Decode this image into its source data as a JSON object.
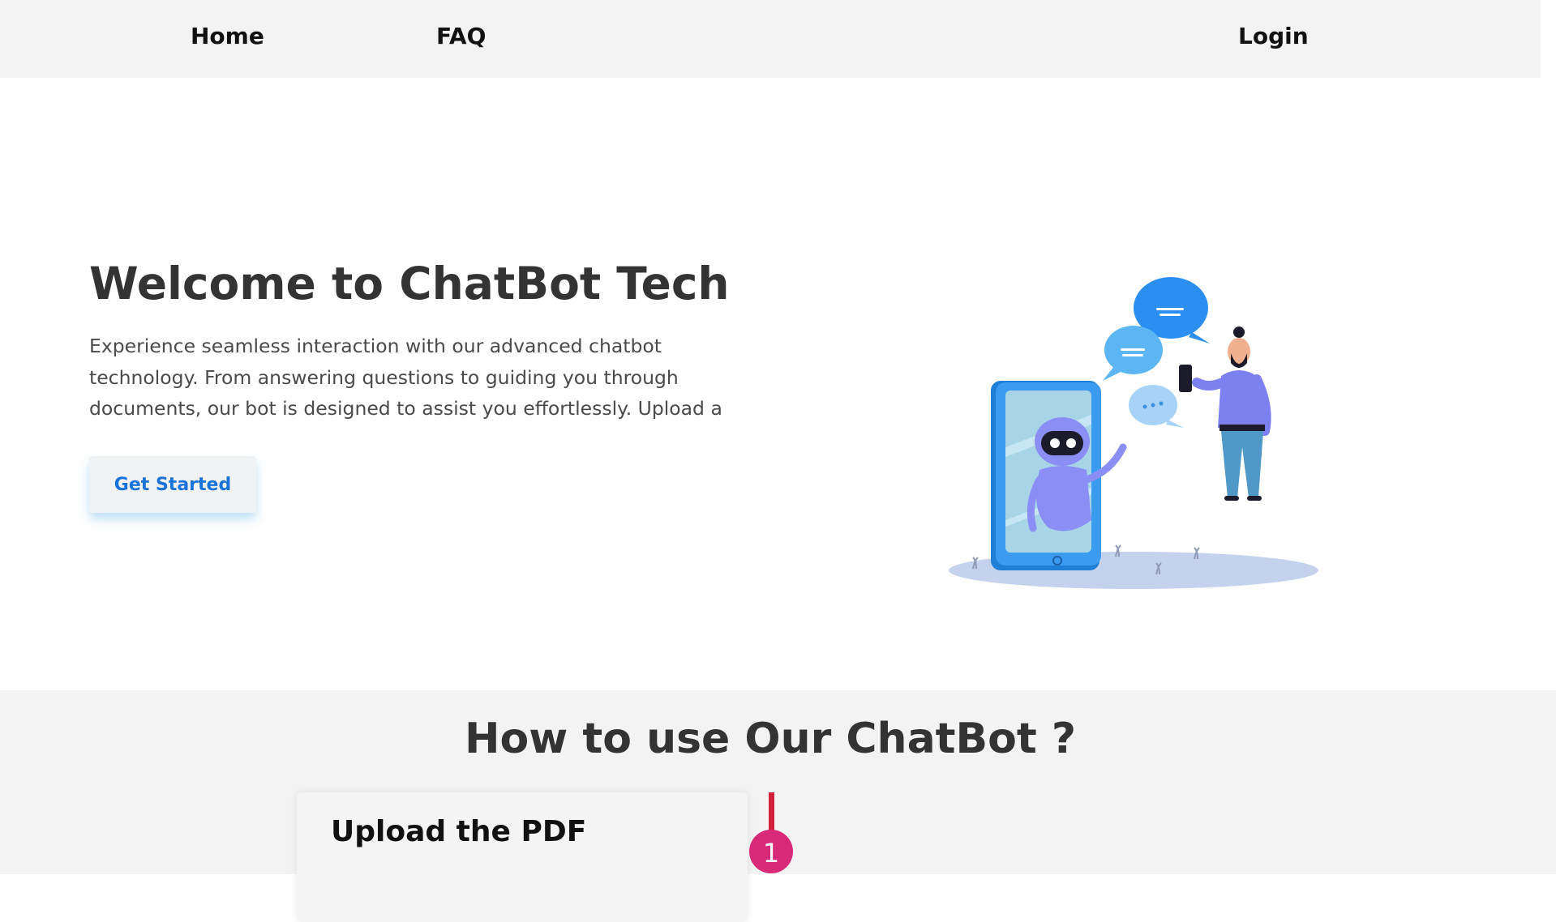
{
  "nav": {
    "home": "Home",
    "faq": "FAQ",
    "login": "Login"
  },
  "hero": {
    "title": "Welcome to ChatBot Tech",
    "description": "Experience seamless interaction with our advanced chatbot technology. From answering questions to guiding you through documents, our bot is designed to assist you effortlessly. Upload a PDF and get started today!",
    "cta_label": "Get Started"
  },
  "how": {
    "title": "How to use Our ChatBot ?",
    "steps": [
      {
        "number": "1",
        "title": "Upload the PDF"
      }
    ]
  },
  "colors": {
    "nav_bg": "#f3f3f3",
    "cta_text": "#1a73d8",
    "timeline_line": "#d3213a",
    "step_badge": "#d92a7a",
    "phone_blue": "#2f8fe8",
    "robot_purple": "#8b8ef5"
  },
  "illustration": "chatbot-phone-and-person-illustration"
}
